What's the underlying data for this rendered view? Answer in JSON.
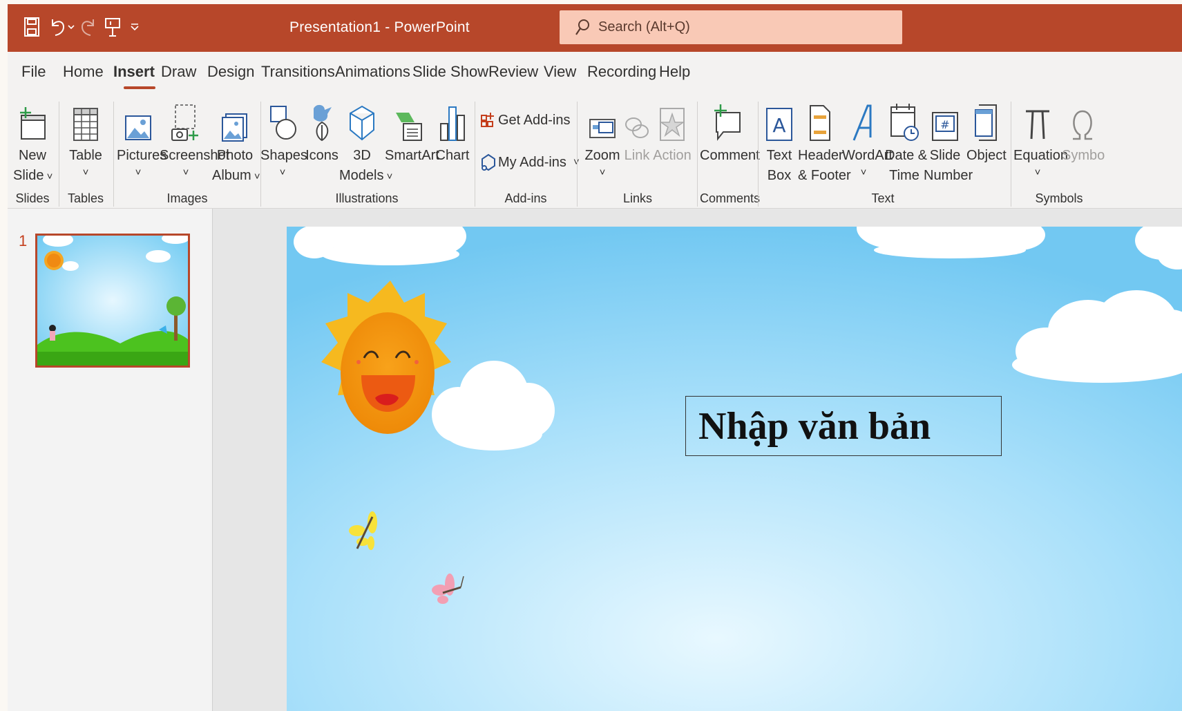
{
  "titlebar": {
    "doc_title": "Presentation1  -  PowerPoint",
    "search_placeholder": "Search (Alt+Q)",
    "colors": {
      "bar": "#b7472a",
      "search_bg": "#f9c9b6"
    },
    "qat_icons": [
      "save-icon",
      "undo-icon",
      "redo-icon",
      "start-from-beginning-icon",
      "customize-qat-icon"
    ]
  },
  "tabs": [
    "File",
    "Home",
    "Insert",
    "Draw",
    "Design",
    "Transitions",
    "Animations",
    "Slide Show",
    "Review",
    "View",
    "Recording",
    "Help"
  ],
  "active_tab": "Insert",
  "ribbon": {
    "new_slide": [
      "New",
      "Slide"
    ],
    "table": "Table",
    "pictures": "Pictures",
    "screenshot": "Screenshot",
    "photo_album": [
      "Photo",
      "Album"
    ],
    "shapes": "Shapes",
    "icons": "Icons",
    "models_3d": [
      "3D",
      "Models"
    ],
    "smartart": "SmartArt",
    "chart": "Chart",
    "get_addins": "Get Add-ins",
    "my_addins": "My Add-ins",
    "zoom": "Zoom",
    "link": "Link",
    "action": "Action",
    "comment": "Comment",
    "text_box": [
      "Text",
      "Box"
    ],
    "header_footer": [
      "Header",
      "& Footer"
    ],
    "wordart": "WordArt",
    "date_time": [
      "Date &",
      "Time"
    ],
    "slide_number": [
      "Slide",
      "Number"
    ],
    "object": "Object",
    "equation": "Equation",
    "symbol": "Symbo",
    "groups": {
      "slides": "Slides",
      "tables": "Tables",
      "images": "Images",
      "illustrations": "Illustrations",
      "addins": "Add-ins",
      "links": "Links",
      "comments": "Comments",
      "text": "Text",
      "symbols": "Symbols"
    }
  },
  "thumbnails": [
    {
      "number": "1"
    }
  ],
  "slide": {
    "textbox_text": "Nhập văn bản"
  }
}
